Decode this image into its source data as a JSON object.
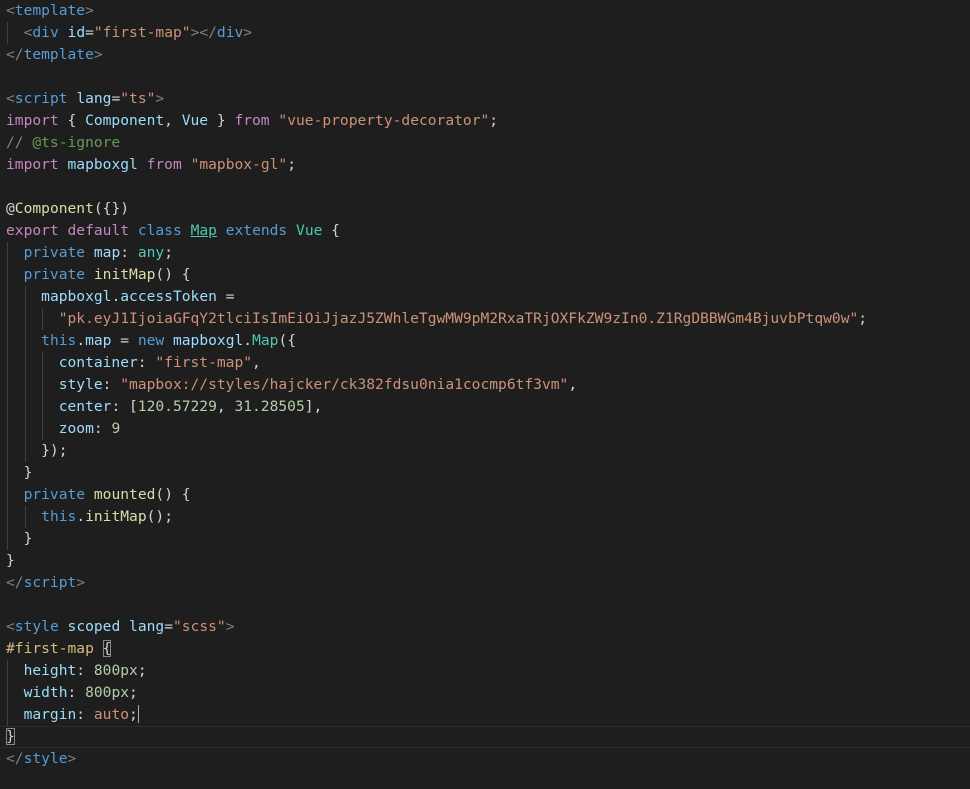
{
  "colors": {
    "background": "#1e1e1e",
    "tag": "#808080",
    "tagname": "#569cd6",
    "attribute": "#9cdcfe",
    "string": "#ce9178",
    "keyword_control": "#c586c0",
    "keyword": "#569cd6",
    "variable": "#9cdcfe",
    "type": "#4ec9b0",
    "function": "#dcdcaa",
    "comment": "#6a9955",
    "number": "#b5cea8",
    "punctuation": "#d4d4d4",
    "css_selector": "#d7ba7d"
  },
  "editor": {
    "cursor_line": 33,
    "lines": [
      {
        "indent": 0,
        "tokens": [
          [
            "tag",
            "<"
          ],
          [
            "tagname",
            "template"
          ],
          [
            "tag",
            ">"
          ]
        ]
      },
      {
        "indent": 1,
        "tokens": [
          [
            "punc",
            "  "
          ],
          [
            "tag",
            "<"
          ],
          [
            "tagname",
            "div"
          ],
          [
            "punc",
            " "
          ],
          [
            "attr",
            "id"
          ],
          [
            "punc",
            "="
          ],
          [
            "str",
            "\"first-map\""
          ],
          [
            "tag",
            "></"
          ],
          [
            "tagname",
            "div"
          ],
          [
            "tag",
            ">"
          ]
        ]
      },
      {
        "indent": 0,
        "tokens": [
          [
            "tag",
            "</"
          ],
          [
            "tagname",
            "template"
          ],
          [
            "tag",
            ">"
          ]
        ]
      },
      {
        "indent": 0,
        "tokens": []
      },
      {
        "indent": 0,
        "tokens": [
          [
            "tag",
            "<"
          ],
          [
            "tagname",
            "script"
          ],
          [
            "punc",
            " "
          ],
          [
            "attr",
            "lang"
          ],
          [
            "punc",
            "="
          ],
          [
            "str",
            "\"ts\""
          ],
          [
            "tag",
            ">"
          ]
        ]
      },
      {
        "indent": 0,
        "tokens": [
          [
            "kw",
            "import"
          ],
          [
            "punc",
            " { "
          ],
          [
            "var",
            "Component"
          ],
          [
            "punc",
            ", "
          ],
          [
            "var",
            "Vue"
          ],
          [
            "punc",
            " } "
          ],
          [
            "kw",
            "from"
          ],
          [
            "punc",
            " "
          ],
          [
            "str",
            "\"vue-property-decorator\""
          ],
          [
            "punc",
            ";"
          ]
        ]
      },
      {
        "indent": 0,
        "tokens": [
          [
            "com",
            "// @ts-ignore"
          ]
        ]
      },
      {
        "indent": 0,
        "tokens": [
          [
            "kw",
            "import"
          ],
          [
            "punc",
            " "
          ],
          [
            "var",
            "mapboxgl"
          ],
          [
            "punc",
            " "
          ],
          [
            "kw",
            "from"
          ],
          [
            "punc",
            " "
          ],
          [
            "str",
            "\"mapbox-gl\""
          ],
          [
            "punc",
            ";"
          ]
        ]
      },
      {
        "indent": 0,
        "tokens": []
      },
      {
        "indent": 0,
        "tokens": [
          [
            "punc",
            "@"
          ],
          [
            "fn",
            "Component"
          ],
          [
            "punc",
            "({})"
          ]
        ]
      },
      {
        "indent": 0,
        "tokens": [
          [
            "kw",
            "export"
          ],
          [
            "punc",
            " "
          ],
          [
            "kw",
            "default"
          ],
          [
            "punc",
            " "
          ],
          [
            "kw2",
            "class"
          ],
          [
            "punc",
            " "
          ],
          [
            "clsul",
            "Map"
          ],
          [
            "punc",
            " "
          ],
          [
            "kw2",
            "extends"
          ],
          [
            "punc",
            " "
          ],
          [
            "type",
            "Vue"
          ],
          [
            "punc",
            " {"
          ]
        ]
      },
      {
        "indent": 1,
        "tokens": [
          [
            "punc",
            "  "
          ],
          [
            "kw2",
            "private"
          ],
          [
            "punc",
            " "
          ],
          [
            "var",
            "map"
          ],
          [
            "punc",
            ": "
          ],
          [
            "type",
            "any"
          ],
          [
            "punc",
            ";"
          ]
        ]
      },
      {
        "indent": 1,
        "tokens": [
          [
            "punc",
            "  "
          ],
          [
            "kw2",
            "private"
          ],
          [
            "punc",
            " "
          ],
          [
            "fn",
            "initMap"
          ],
          [
            "punc",
            "() {"
          ]
        ]
      },
      {
        "indent": 2,
        "tokens": [
          [
            "punc",
            "    "
          ],
          [
            "var",
            "mapboxgl"
          ],
          [
            "punc",
            "."
          ],
          [
            "var",
            "accessToken"
          ],
          [
            "punc",
            " ="
          ]
        ]
      },
      {
        "indent": 3,
        "tokens": [
          [
            "punc",
            "      "
          ],
          [
            "str",
            "\"pk.eyJ1IjoiaGFqY2tlciIsImEiOiJjazJ5ZWhleTgwMW9pM2RxaTRjOXFkZW9zIn0.Z1RgDBBWGm4BjuvbPtqw0w\""
          ],
          [
            "punc",
            ";"
          ]
        ]
      },
      {
        "indent": 2,
        "tokens": [
          [
            "punc",
            "    "
          ],
          [
            "kw2",
            "this"
          ],
          [
            "punc",
            "."
          ],
          [
            "var",
            "map"
          ],
          [
            "punc",
            " = "
          ],
          [
            "kw2",
            "new"
          ],
          [
            "punc",
            " "
          ],
          [
            "var",
            "mapboxgl"
          ],
          [
            "punc",
            "."
          ],
          [
            "type",
            "Map"
          ],
          [
            "punc",
            "({"
          ]
        ]
      },
      {
        "indent": 3,
        "tokens": [
          [
            "punc",
            "      "
          ],
          [
            "var",
            "container"
          ],
          [
            "punc",
            ": "
          ],
          [
            "str",
            "\"first-map\""
          ],
          [
            "punc",
            ","
          ]
        ]
      },
      {
        "indent": 3,
        "tokens": [
          [
            "punc",
            "      "
          ],
          [
            "var",
            "style"
          ],
          [
            "punc",
            ": "
          ],
          [
            "str",
            "\"mapbox://styles/hajcker/ck382fdsu0nia1cocmp6tf3vm\""
          ],
          [
            "punc",
            ","
          ]
        ]
      },
      {
        "indent": 3,
        "tokens": [
          [
            "punc",
            "      "
          ],
          [
            "var",
            "center"
          ],
          [
            "punc",
            ": ["
          ],
          [
            "num",
            "120.57229"
          ],
          [
            "punc",
            ", "
          ],
          [
            "num",
            "31.28505"
          ],
          [
            "punc",
            "],"
          ]
        ]
      },
      {
        "indent": 3,
        "tokens": [
          [
            "punc",
            "      "
          ],
          [
            "var",
            "zoom"
          ],
          [
            "punc",
            ": "
          ],
          [
            "num",
            "9"
          ]
        ]
      },
      {
        "indent": 2,
        "tokens": [
          [
            "punc",
            "    });"
          ]
        ]
      },
      {
        "indent": 1,
        "tokens": [
          [
            "punc",
            "  }"
          ]
        ]
      },
      {
        "indent": 1,
        "tokens": [
          [
            "punc",
            "  "
          ],
          [
            "kw2",
            "private"
          ],
          [
            "punc",
            " "
          ],
          [
            "fn",
            "mounted"
          ],
          [
            "punc",
            "() {"
          ]
        ]
      },
      {
        "indent": 2,
        "tokens": [
          [
            "punc",
            "    "
          ],
          [
            "kw2",
            "this"
          ],
          [
            "punc",
            "."
          ],
          [
            "fn",
            "initMap"
          ],
          [
            "punc",
            "();"
          ]
        ]
      },
      {
        "indent": 1,
        "tokens": [
          [
            "punc",
            "  }"
          ]
        ]
      },
      {
        "indent": 0,
        "tokens": [
          [
            "punc",
            "}"
          ]
        ]
      },
      {
        "indent": 0,
        "tokens": [
          [
            "tag",
            "</"
          ],
          [
            "tagname",
            "script"
          ],
          [
            "tag",
            ">"
          ]
        ]
      },
      {
        "indent": 0,
        "tokens": []
      },
      {
        "indent": 0,
        "tokens": [
          [
            "tag",
            "<"
          ],
          [
            "tagname",
            "style"
          ],
          [
            "punc",
            " "
          ],
          [
            "attr",
            "scoped"
          ],
          [
            "punc",
            " "
          ],
          [
            "attr",
            "lang"
          ],
          [
            "punc",
            "="
          ],
          [
            "str",
            "\"scss\""
          ],
          [
            "tag",
            ">"
          ]
        ]
      },
      {
        "indent": 0,
        "tokens": [
          [
            "sel",
            "#first-map"
          ],
          [
            "punc",
            " "
          ],
          [
            "match",
            "{"
          ]
        ]
      },
      {
        "indent": 1,
        "tokens": [
          [
            "punc",
            "  "
          ],
          [
            "prop",
            "height"
          ],
          [
            "punc",
            ": "
          ],
          [
            "num",
            "800px"
          ],
          [
            "punc",
            ";"
          ]
        ]
      },
      {
        "indent": 1,
        "tokens": [
          [
            "punc",
            "  "
          ],
          [
            "prop",
            "width"
          ],
          [
            "punc",
            ": "
          ],
          [
            "num",
            "800px"
          ],
          [
            "punc",
            ";"
          ]
        ]
      },
      {
        "indent": 1,
        "tokens": [
          [
            "punc",
            "  "
          ],
          [
            "prop",
            "margin"
          ],
          [
            "punc",
            ": "
          ],
          [
            "str",
            "auto"
          ],
          [
            "punc",
            ";"
          ],
          [
            "cursor",
            ""
          ]
        ]
      },
      {
        "indent": 0,
        "tokens": [
          [
            "match",
            "}"
          ]
        ]
      },
      {
        "indent": 0,
        "tokens": [
          [
            "tag",
            "</"
          ],
          [
            "tagname",
            "style"
          ],
          [
            "tag",
            ">"
          ]
        ]
      }
    ]
  }
}
